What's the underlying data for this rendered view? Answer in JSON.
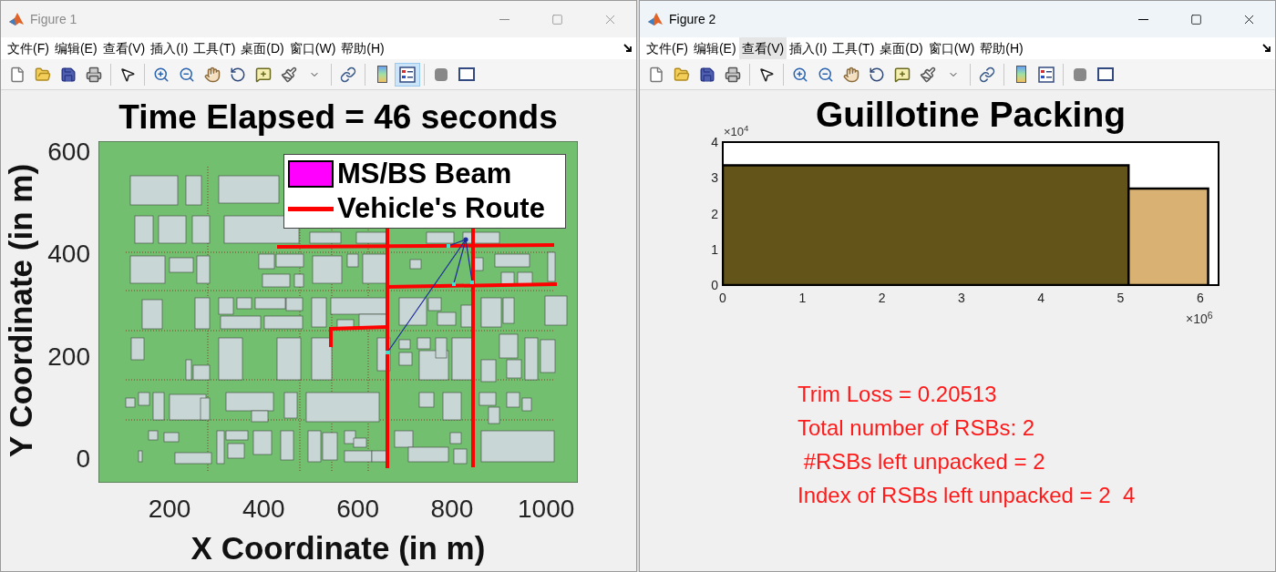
{
  "windows": [
    {
      "title": "Figure 1",
      "active": false,
      "menu": [
        {
          "label": "文件(F)",
          "highlighted": false
        },
        {
          "label": "编辑(E)",
          "highlighted": false
        },
        {
          "label": "查看(V)",
          "highlighted": false
        },
        {
          "label": "插入(I)",
          "highlighted": false
        },
        {
          "label": "工具(T)",
          "highlighted": false
        },
        {
          "label": "桌面(D)",
          "highlighted": false
        },
        {
          "label": "窗口(W)",
          "highlighted": false
        },
        {
          "label": "帮助(H)",
          "highlighted": false
        }
      ],
      "legend_toggle": {
        "pressed": true
      },
      "figure": {
        "kind": "map",
        "title": "Time Elapsed = 46 seconds",
        "xlabel": "X Coordinate (in m)",
        "ylabel": "Y Coordinate (in m)",
        "xticks": [
          "200",
          "400",
          "600",
          "800",
          "1000"
        ],
        "yticks": [
          "600",
          "400",
          "200",
          "0"
        ],
        "legend": [
          {
            "label": "MS/BS Beam",
            "kind": "patch",
            "color": "#ff00ff"
          },
          {
            "label": "Vehicle's Route",
            "kind": "line",
            "color": "#ff0000"
          }
        ]
      }
    },
    {
      "title": "Figure 2",
      "active": true,
      "menu": [
        {
          "label": "文件(F)",
          "highlighted": false
        },
        {
          "label": "编辑(E)",
          "highlighted": false
        },
        {
          "label": "查看(V)",
          "highlighted": true
        },
        {
          "label": "插入(I)",
          "highlighted": false
        },
        {
          "label": "工具(T)",
          "highlighted": false
        },
        {
          "label": "桌面(D)",
          "highlighted": false
        },
        {
          "label": "窗口(W)",
          "highlighted": false
        },
        {
          "label": "帮助(H)",
          "highlighted": false
        }
      ],
      "legend_toggle": {
        "pressed": false
      },
      "figure": {
        "kind": "packing",
        "title": "Guillotine Packing",
        "y_exponent": "×10$^{4}$",
        "x_exponent": "×10$^{6}$",
        "xticks": [
          "0",
          "1",
          "2",
          "3",
          "4",
          "5",
          "6"
        ],
        "yticks": [
          "4",
          "3",
          "2",
          "1",
          "0"
        ],
        "blocks": [
          {
            "color": "#63551a"
          },
          {
            "color": "#d9b273"
          }
        ],
        "notes": [
          "Trim Loss = 0.20513",
          "Total number of RSBs: 2",
          " #RSBs left unpacked = 2",
          "Index of RSBs left unpacked = 2  4"
        ]
      }
    }
  ]
}
